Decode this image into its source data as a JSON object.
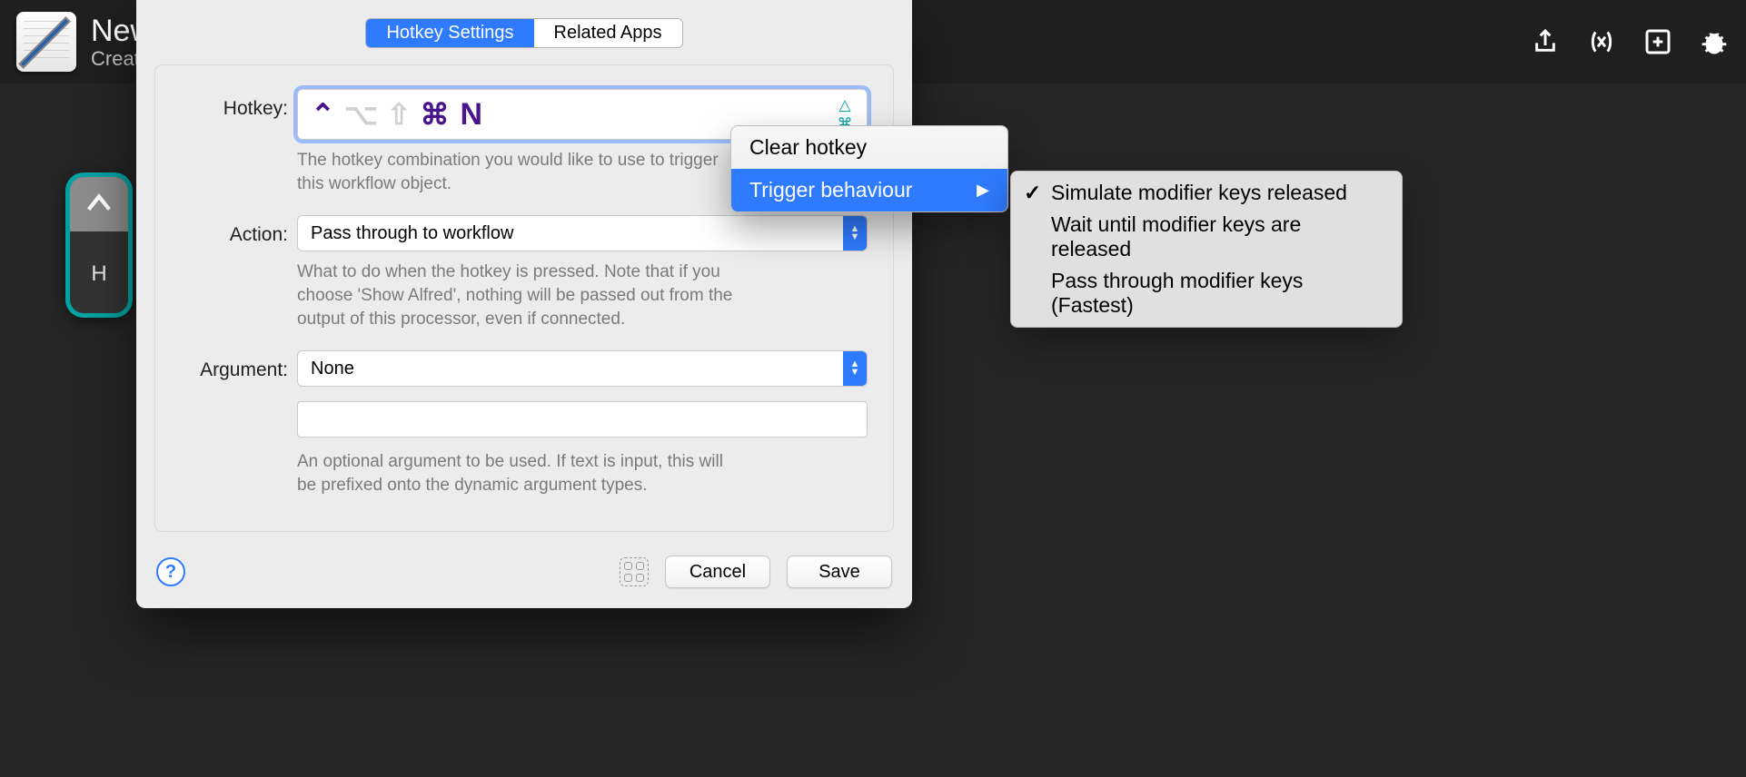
{
  "topbar": {
    "title": "New",
    "subtitle": "Creat"
  },
  "wf": {
    "body": "H"
  },
  "tabs": {
    "hotkey": "Hotkey Settings",
    "related": "Related Apps"
  },
  "hotkey": {
    "label": "Hotkey:",
    "letter": "N",
    "hint": "The hotkey combination you would like to use to trigger this workflow object."
  },
  "action": {
    "label": "Action:",
    "value": "Pass through to workflow",
    "hint": "What to do when the hotkey is pressed. Note that if you choose 'Show Alfred', nothing will be passed out from the output of this processor, even if connected."
  },
  "argument": {
    "label": "Argument:",
    "value": "None",
    "hint": "An optional argument to be used. If text is input, this will be prefixed onto the dynamic argument types."
  },
  "footer": {
    "cancel": "Cancel",
    "save": "Save",
    "help": "?"
  },
  "ctx": {
    "clear": "Clear hotkey",
    "trigger": "Trigger behaviour"
  },
  "submenu": {
    "opt1": "Simulate modifier keys released",
    "opt2": "Wait until modifier keys are released",
    "opt3": "Pass through modifier keys (Fastest)"
  }
}
